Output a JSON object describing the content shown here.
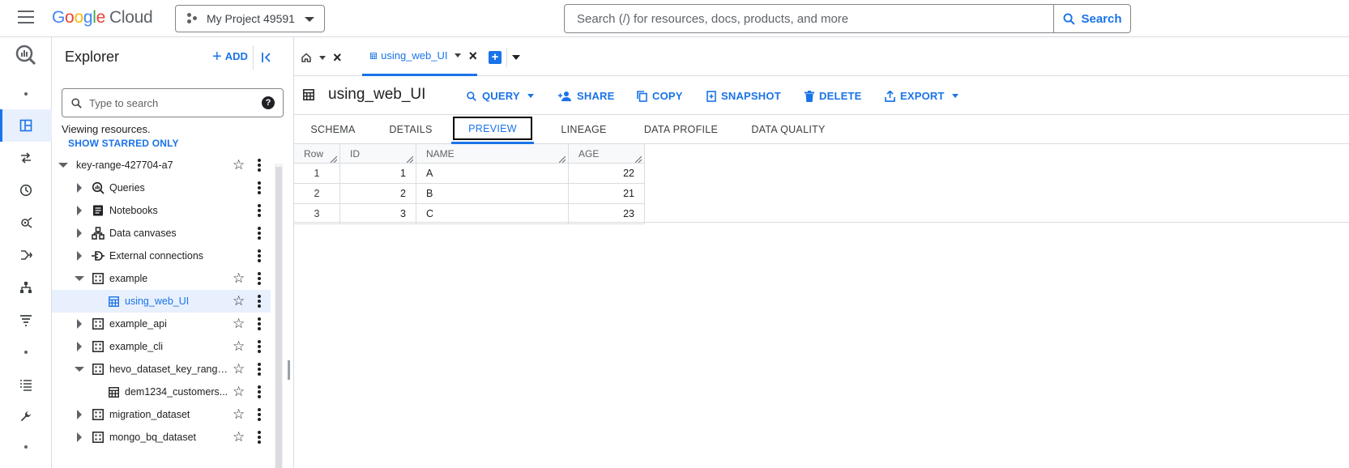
{
  "header": {
    "logo_letters": [
      "G",
      "o",
      "o",
      "g",
      "l",
      "e"
    ],
    "logo_cloud": "Cloud",
    "project_name": "My Project 49591",
    "search_placeholder": "Search (/) for resources, docs, products, and more",
    "search_button": "Search"
  },
  "explorer": {
    "title": "Explorer",
    "add_label": "ADD",
    "search_placeholder": "Type to search",
    "help_glyph": "?",
    "viewing_text": "Viewing resources.",
    "show_starred": "SHOW STARRED ONLY",
    "tree": [
      {
        "label": "key-range-427704-a7",
        "icon": "project-icon",
        "expanded": true,
        "starred": true
      },
      {
        "label": "Queries",
        "icon": "queries-icon",
        "expanded": false,
        "starred": false
      },
      {
        "label": "Notebooks",
        "icon": "notebook-icon",
        "expanded": false,
        "starred": false
      },
      {
        "label": "Data canvases",
        "icon": "canvas-icon",
        "expanded": false,
        "starred": false
      },
      {
        "label": "External connections",
        "icon": "connection-icon",
        "expanded": false,
        "starred": false
      },
      {
        "label": "example",
        "icon": "dataset-icon",
        "expanded": true,
        "starred": true
      },
      {
        "label": "using_web_UI",
        "icon": "table-icon",
        "selected": true,
        "starred": true
      },
      {
        "label": "example_api",
        "icon": "dataset-icon",
        "expanded": false,
        "starred": true
      },
      {
        "label": "example_cli",
        "icon": "dataset-icon",
        "expanded": false,
        "starred": true
      },
      {
        "label": "hevo_dataset_key_range...",
        "icon": "dataset-icon",
        "expanded": true,
        "starred": true
      },
      {
        "label": "dem1234_customers...",
        "icon": "table-icon",
        "starred": true
      },
      {
        "label": "migration_dataset",
        "icon": "dataset-icon",
        "expanded": false,
        "starred": true
      },
      {
        "label": "mongo_bq_dataset",
        "icon": "dataset-icon",
        "expanded": false,
        "starred": true
      }
    ]
  },
  "tabs": {
    "active_tab_label": "using_web_UI"
  },
  "toolbar": {
    "title": "using_web_UI",
    "query": "QUERY",
    "share": "SHARE",
    "copy": "COPY",
    "snapshot": "SNAPSHOT",
    "delete": "DELETE",
    "export": "EXPORT"
  },
  "subtabs": {
    "schema": "SCHEMA",
    "details": "DETAILS",
    "preview": "PREVIEW",
    "lineage": "LINEAGE",
    "data_profile": "DATA PROFILE",
    "data_quality": "DATA QUALITY",
    "active": "preview"
  },
  "preview_table": {
    "columns": [
      "Row",
      "ID",
      "NAME",
      "AGE"
    ],
    "rows": [
      [
        "1",
        "1",
        "A",
        "22"
      ],
      [
        "2",
        "2",
        "B",
        "21"
      ],
      [
        "3",
        "3",
        "C",
        "23"
      ]
    ]
  },
  "colors": {
    "accent": "#1a73e8",
    "border": "#dadce0",
    "selected_bg": "#e8f0fe"
  }
}
